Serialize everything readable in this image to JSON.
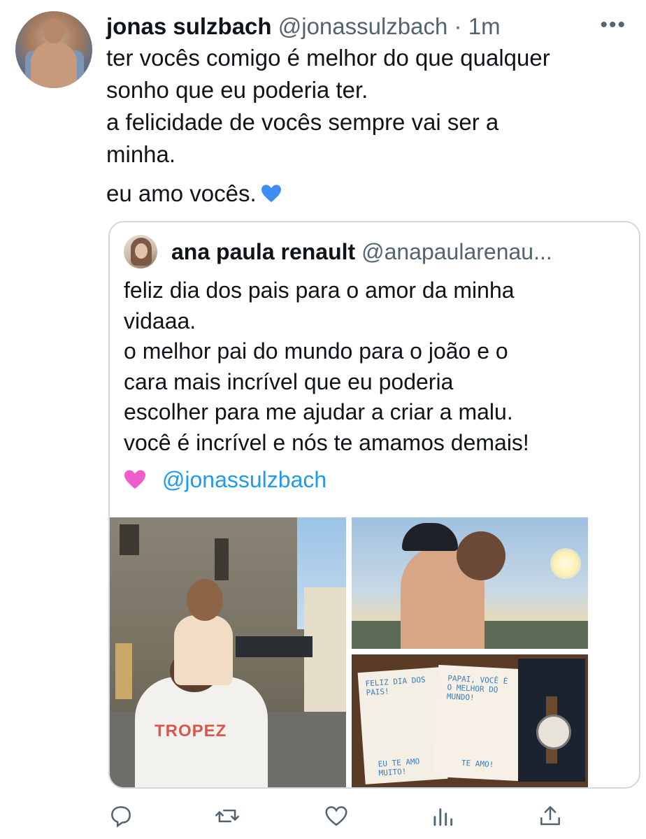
{
  "tweet": {
    "author_name": "jonas sulzbach",
    "author_handle": "@jonassulzbach",
    "separator": "·",
    "time": "1m",
    "more_label": "•••",
    "lines": [
      "ter vocês comigo é melhor do que qualquer",
      "sonho que eu poderia ter.",
      "a felicidade de vocês sempre vai ser a",
      "minha."
    ],
    "last_line": "eu amo vocês.",
    "emoji": "blue-heart"
  },
  "quoted": {
    "author_name": "ana paula renault",
    "author_handle": "@anapaularenau...",
    "lines": [
      "feliz dia dos pais para o amor da minha",
      "vidaaa.",
      "o melhor pai do mundo para o joão e o",
      "cara mais incrível que eu poderia",
      "escolher para me ajudar a criar a malu.",
      "você é incrível e nós te amamos demais!"
    ],
    "mention_emoji": "pink-heart",
    "mention": "@jonassulzbach",
    "photos": {
      "shirt_text": "TROPEZ",
      "card1_text": "FELIZ DIA DOS PAIS!",
      "card1_bottom": "EU TE AMO MUITO!",
      "card2_text": "PAPAI, VOCÊ É O MELHOR DO MUNDO!",
      "card2_bottom": "TE AMO!"
    }
  },
  "actions": [
    "reply-icon",
    "retweet-icon",
    "like-icon",
    "views-icon",
    "share-icon"
  ],
  "colors": {
    "text": "#0f1419",
    "secondary": "#536471",
    "link": "#1d9bf0",
    "border": "#cfd9de"
  }
}
